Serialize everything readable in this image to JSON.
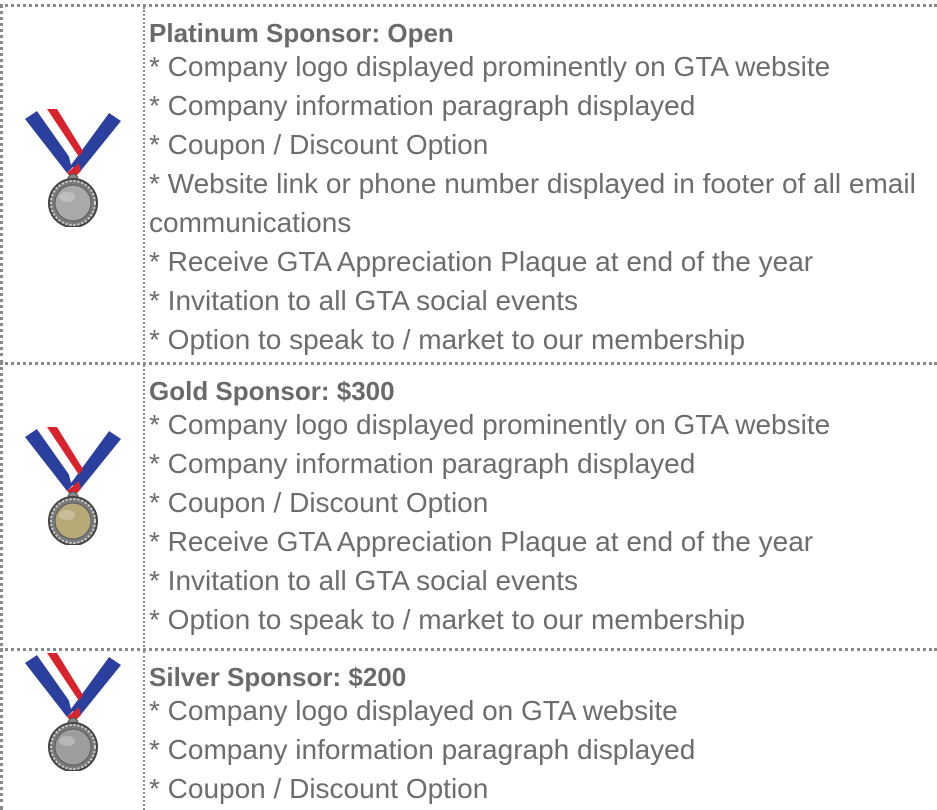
{
  "tiers": [
    {
      "title": "Platinum Sponsor: Open",
      "medal_color": "#a9a9a9",
      "items": [
        "* Company logo displayed prominently on GTA website",
        "* Company information paragraph displayed",
        "* Coupon / Discount Option",
        "* Website link or phone number displayed in footer of all email communications",
        "* Receive GTA Appreciation Plaque at end of the year",
        "* Invitation to all GTA social events",
        "* Option to speak to / market to our membership"
      ]
    },
    {
      "title": "Gold Sponsor: $300",
      "medal_color": "#b8a978",
      "items": [
        "* Company logo displayed prominently on GTA website",
        "* Company information paragraph displayed",
        "* Coupon / Discount Option",
        "* Receive GTA Appreciation Plaque at end of the year",
        "* Invitation to all GTA social events",
        "* Option to speak to / market to our membership"
      ]
    },
    {
      "title": "Silver Sponsor: $200",
      "medal_color": "#9e9e9e",
      "items": [
        "* Company logo displayed on GTA website",
        "* Company information paragraph displayed",
        "* Coupon / Discount Option"
      ]
    }
  ],
  "ribbon_colors": {
    "blue": "#2b3f9e",
    "white": "#ffffff",
    "red": "#d8232a"
  }
}
